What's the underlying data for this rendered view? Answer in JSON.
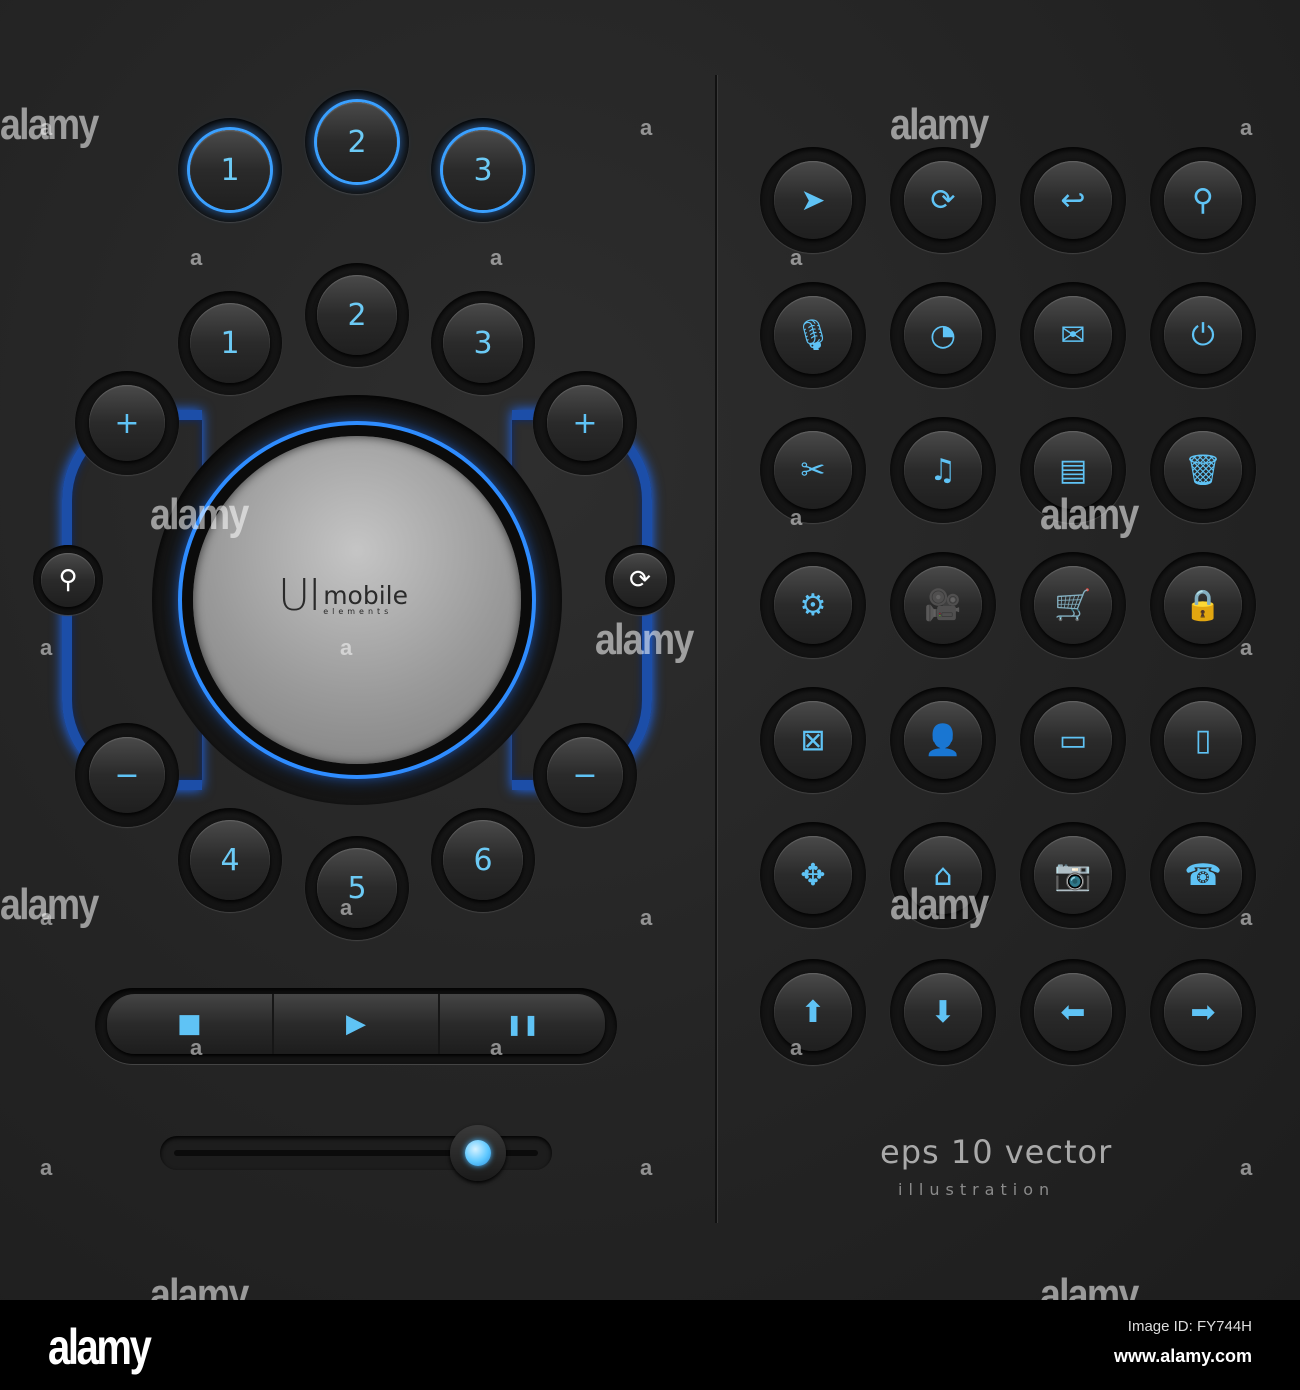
{
  "accent_color": "#5fc3f5",
  "glow_color": "#2e8cff",
  "number_buttons_glow": [
    "1",
    "2",
    "3"
  ],
  "number_buttons_top": [
    "1",
    "2",
    "3"
  ],
  "number_buttons_bottom": [
    "4",
    "5",
    "6"
  ],
  "controls": {
    "plus": "+",
    "minus": "−",
    "search_glyph": "⚲",
    "refresh_glyph": "⟳"
  },
  "center": {
    "logo_main": "UI",
    "logo_word": "mobile",
    "logo_sub": "elements"
  },
  "media": {
    "stop": "■",
    "play": "▶",
    "pause": "❚❚"
  },
  "slider": {
    "value_percent": 81
  },
  "icons": [
    {
      "name": "cursor",
      "glyph": "➤"
    },
    {
      "name": "refresh",
      "glyph": "⟳"
    },
    {
      "name": "undo",
      "glyph": "↩"
    },
    {
      "name": "search",
      "glyph": "⚲"
    },
    {
      "name": "microphone",
      "glyph": "🎙"
    },
    {
      "name": "rss",
      "glyph": "◔"
    },
    {
      "name": "mail",
      "glyph": "✉"
    },
    {
      "name": "power",
      "glyph": "⏻"
    },
    {
      "name": "tools",
      "glyph": "✂"
    },
    {
      "name": "music",
      "glyph": "♫"
    },
    {
      "name": "document",
      "glyph": "▤"
    },
    {
      "name": "trash",
      "glyph": "🗑"
    },
    {
      "name": "gear",
      "glyph": "⚙"
    },
    {
      "name": "video-camera",
      "glyph": "🎥"
    },
    {
      "name": "cart",
      "glyph": "🛒"
    },
    {
      "name": "lock",
      "glyph": "🔒"
    },
    {
      "name": "fullscreen",
      "glyph": "⊠"
    },
    {
      "name": "user",
      "glyph": "👤"
    },
    {
      "name": "battery",
      "glyph": "▭"
    },
    {
      "name": "phone-mobile",
      "glyph": "▯"
    },
    {
      "name": "move",
      "glyph": "✥"
    },
    {
      "name": "home",
      "glyph": "⌂"
    },
    {
      "name": "camera",
      "glyph": "📷"
    },
    {
      "name": "hang-up",
      "glyph": "☎"
    },
    {
      "name": "arrow-up",
      "glyph": "⬆"
    },
    {
      "name": "arrow-down",
      "glyph": "⬇"
    },
    {
      "name": "arrow-left",
      "glyph": "⬅"
    },
    {
      "name": "arrow-right",
      "glyph": "➡"
    }
  ],
  "caption": {
    "title": "eps 10 vector",
    "subtitle": "illustration"
  },
  "watermark": {
    "text": "alamy",
    "mark": "a",
    "image_id": "Image ID: FY744H",
    "url": "www.alamy.com"
  }
}
